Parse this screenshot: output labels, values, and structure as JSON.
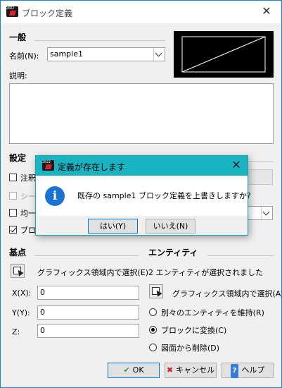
{
  "window": {
    "title": "ブロック定義",
    "icon_year": "2022",
    "close_glyph": "✕"
  },
  "general": {
    "section": "一般",
    "name_label": "名前(N):",
    "name_value": "sample1",
    "desc_label": "説明:",
    "desc_value": ""
  },
  "settings": {
    "section": "設定",
    "items": [
      {
        "label": "注釈",
        "checked": false,
        "enabled": true
      },
      {
        "label": "シー",
        "checked": false,
        "enabled": false
      },
      {
        "label": "均一",
        "checked": false,
        "enabled": true
      },
      {
        "label": "ブロ",
        "checked": true,
        "enabled": true
      }
    ]
  },
  "base_point": {
    "section": "基点",
    "pick_label": "グラフィックス領域内で選択(E)",
    "x_label": "X(X):",
    "x_value": "0",
    "y_label": "Y(Y):",
    "y_value": "0",
    "z_label": "Z:",
    "z_value": "0"
  },
  "entities": {
    "section": "エンティティ",
    "status": "2 エンティティが選択されました",
    "pick_label": "グラフィックス領域内で選択(A)",
    "options": [
      {
        "label": "別々のエンティティを維持(R)",
        "checked": false
      },
      {
        "label": "ブロックに変換(C)",
        "checked": true
      },
      {
        "label": "図面から削除(D)",
        "checked": false
      }
    ]
  },
  "footer": {
    "ok_label": "OK",
    "ok_icon": "✔",
    "cancel_label": "キャンセル",
    "cancel_icon": "✖",
    "help_label": "ヘルプ",
    "help_icon": "?"
  },
  "modal": {
    "title": "定義が存在します",
    "icon_year": "2022",
    "info_glyph": "i",
    "message": "既存の sample1 ブロック定義を上書きしますか?",
    "yes_label": "はい(Y)",
    "no_label": "いいえ(N)",
    "close_glyph": "✕"
  },
  "colors": {
    "accent": "#0078d7",
    "modal_title_bg": "#19b3c2",
    "info_icon": "#1a73d2",
    "ok_check": "#2a9d2a",
    "cancel_x": "#d22222"
  }
}
